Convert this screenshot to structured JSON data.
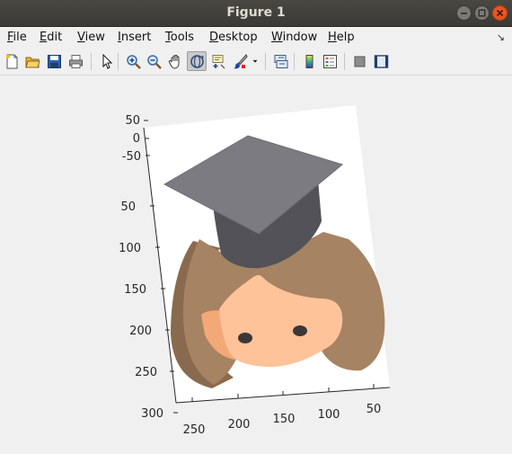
{
  "window": {
    "title": "Figure 1"
  },
  "menu": [
    {
      "label": "File",
      "accel": "F",
      "rest": "ile"
    },
    {
      "label": "Edit",
      "accel": "E",
      "rest": "dit"
    },
    {
      "label": "View",
      "accel": "V",
      "rest": "iew"
    },
    {
      "label": "Insert",
      "accel": "I",
      "rest": "nsert"
    },
    {
      "label": "Tools",
      "accel": "T",
      "rest": "ools"
    },
    {
      "label": "Desktop",
      "accel": "D",
      "rest": "esktop"
    },
    {
      "label": "Window",
      "accel": "W",
      "rest": "indow"
    },
    {
      "label": "Help",
      "accel": "H",
      "rest": "elp"
    }
  ],
  "toolbar": [
    {
      "name": "new-figure-icon"
    },
    {
      "name": "open-file-icon"
    },
    {
      "name": "save-figure-icon"
    },
    {
      "name": "print-figure-icon"
    },
    {
      "name": "edit-plot-icon"
    },
    {
      "name": "zoom-in-icon"
    },
    {
      "name": "zoom-out-icon"
    },
    {
      "name": "pan-icon"
    },
    {
      "name": "rotate-3d-icon",
      "active": true
    },
    {
      "name": "data-cursor-icon"
    },
    {
      "name": "brush-icon"
    },
    {
      "name": "brush-dropdown-icon"
    },
    {
      "name": "link-plot-icon"
    },
    {
      "name": "insert-colorbar-icon"
    },
    {
      "name": "insert-legend-icon"
    },
    {
      "name": "hide-plot-tools-icon"
    },
    {
      "name": "show-plot-tools-icon"
    }
  ],
  "axes": {
    "y_ticks": [
      "50",
      "0",
      "-50",
      "50",
      "100",
      "150",
      "200",
      "250",
      "300"
    ],
    "x_ticks": [
      "250",
      "200",
      "150",
      "100",
      "50"
    ]
  },
  "colors": {
    "cap_top": "#7c7b82",
    "cap_band": "#535259",
    "hair": "#a68362",
    "hair_shadow": "#8a6a4e",
    "face": "#ffc39a",
    "face_shadow": "#f3a878",
    "eyes": "#3b3738"
  }
}
